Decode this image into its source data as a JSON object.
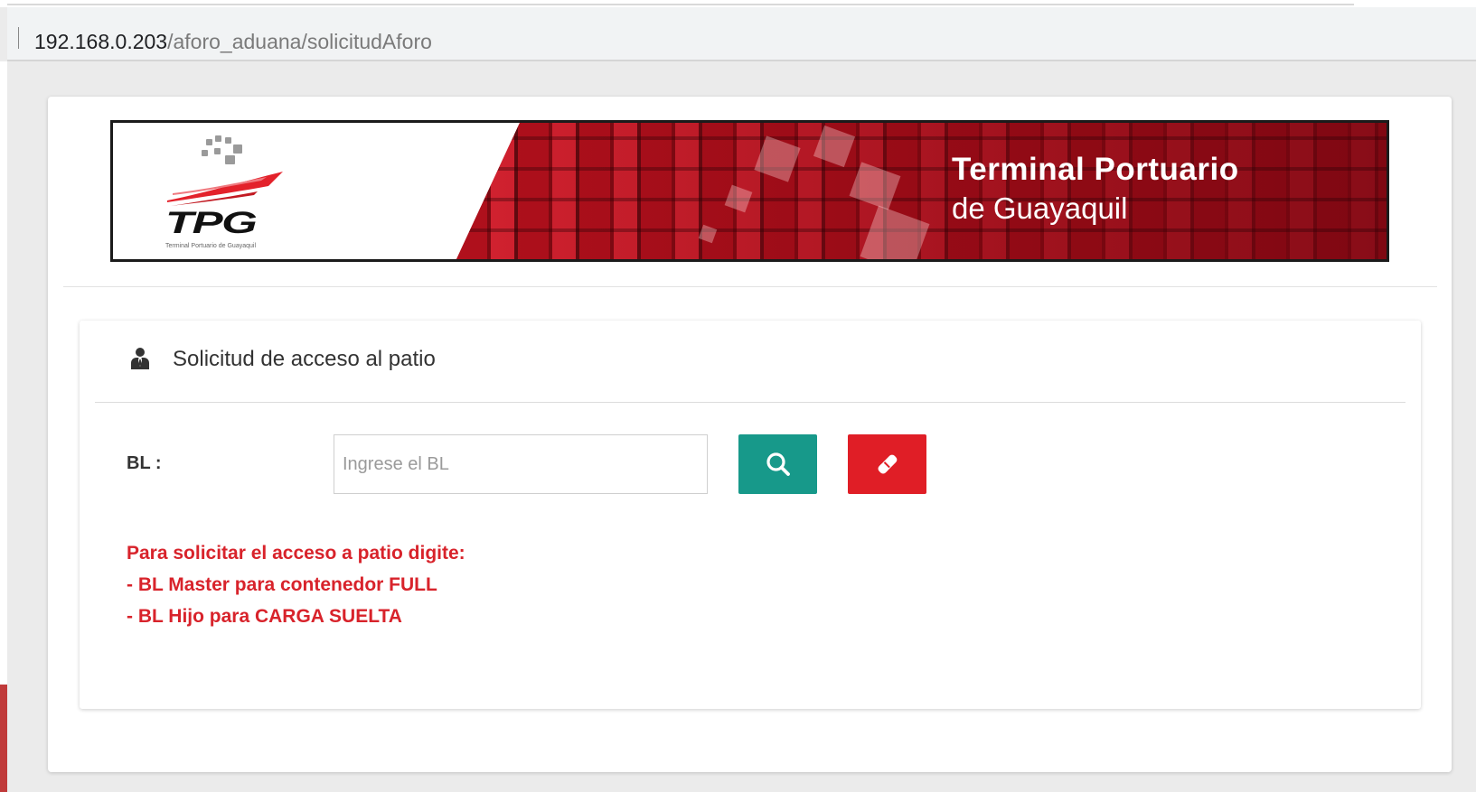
{
  "browser": {
    "url_host": "192.168.0.203",
    "url_path": "/aforo_aduana/solicitudAforo"
  },
  "banner": {
    "logo_text": "TPG",
    "logo_subtext": "Terminal Portuario de Guayaquil",
    "title_line1": "Terminal Portuario",
    "title_line2": "de Guayaquil"
  },
  "panel": {
    "icon": "user-tie-icon",
    "title": "Solicitud de acceso al patio"
  },
  "form": {
    "bl_label": "BL :",
    "bl_value": "",
    "bl_placeholder": "Ingrese el BL",
    "search_icon": "search-icon",
    "clear_icon": "eraser-icon"
  },
  "instructions": {
    "line1": "Para solicitar el acceso a patio digite:",
    "line2": "- BL Master para contenedor FULL",
    "line3": "- BL Hijo para CARGA SUELTA"
  },
  "colors": {
    "search_button": "#17998a",
    "clear_button": "#e01e26",
    "instruction_text": "#d8232b",
    "banner_red": "#b0101c"
  }
}
